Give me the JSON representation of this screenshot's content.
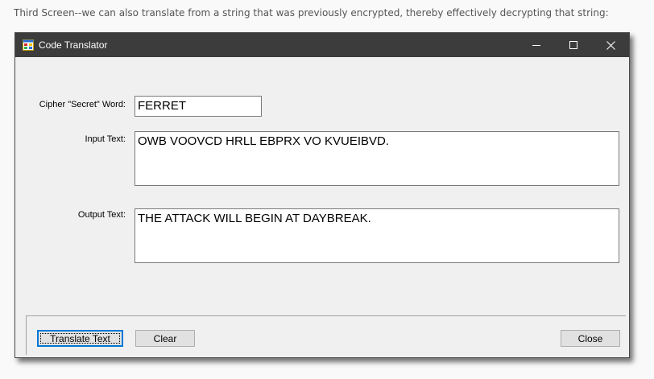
{
  "caption": "Third Screen--we can also translate from a string that was previously encrypted, thereby effectively decrypting that string:",
  "window": {
    "title": "Code Translator",
    "icon": "app-form-icon",
    "controls": {
      "minimize": "minimize-icon",
      "maximize": "maximize-icon",
      "close": "close-icon"
    }
  },
  "form": {
    "cipher_label": "Cipher \"Secret\" Word:",
    "cipher_value": "FERRET",
    "input_label": "Input Text:",
    "input_value": "OWB VOOVCD HRLL EBPRX VO KVUEIBVD.",
    "output_label": "Output Text:",
    "output_value": "THE ATTACK WILL BEGIN AT DAYBREAK."
  },
  "buttons": {
    "translate": "Translate Text",
    "clear": "Clear",
    "close": "Close"
  },
  "colors": {
    "titlebar": "#3c3c3c",
    "window_bg": "#f0f0f0",
    "focus_border": "#0078d7"
  }
}
